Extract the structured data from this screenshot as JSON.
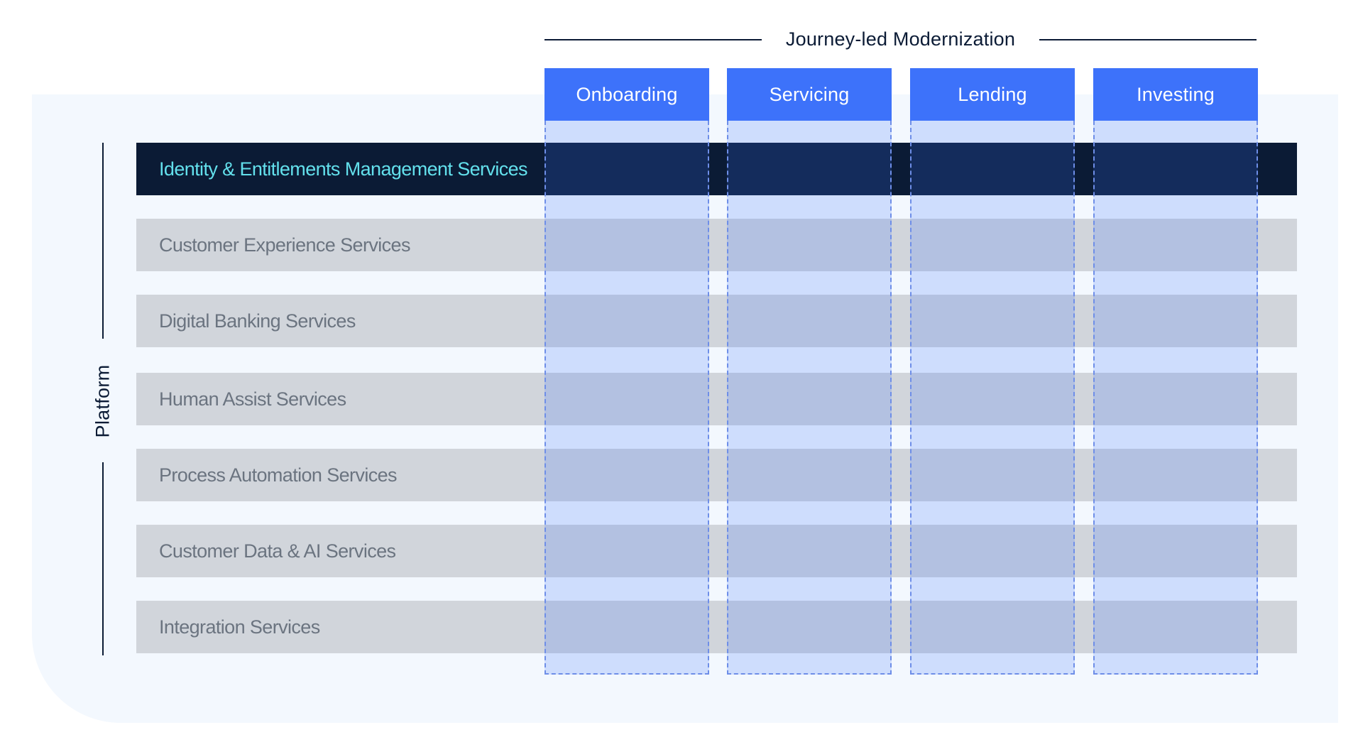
{
  "header": {
    "title": "Journey-led Modernization"
  },
  "axis": {
    "label": "Platform"
  },
  "journeys": [
    {
      "label": "Onboarding"
    },
    {
      "label": "Servicing"
    },
    {
      "label": "Lending"
    },
    {
      "label": "Investing"
    }
  ],
  "services": [
    {
      "label": "Identity & Entitlements Management Services",
      "highlighted": true
    },
    {
      "label": "Customer Experience Services",
      "highlighted": false
    },
    {
      "label": "Digital Banking Services",
      "highlighted": false
    },
    {
      "label": "Human Assist Services",
      "highlighted": false
    },
    {
      "label": "Process Automation Services",
      "highlighted": false
    },
    {
      "label": "Customer Data & AI Services",
      "highlighted": false
    },
    {
      "label": "Integration Services",
      "highlighted": false
    }
  ],
  "colors": {
    "journey_header": "#3d72fa",
    "highlight_row": "#0b1b35",
    "highlight_text": "#63e0ec",
    "service_row": "#d1d5db",
    "panel_background": "#f3f8fe"
  }
}
